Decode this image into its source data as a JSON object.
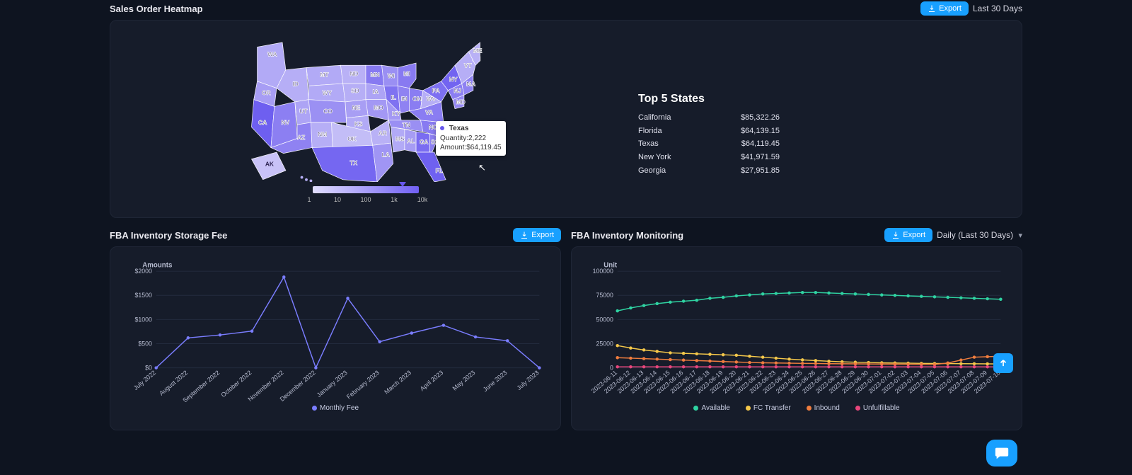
{
  "heatmap": {
    "title": "Sales Order Heatmap",
    "export": "Export",
    "range": "Last 30 Days",
    "tooltip": {
      "state": "Texas",
      "qty_label": "Quantity:",
      "qty": "2,222",
      "amt_label": "Amount:",
      "amt": "$64,119.45"
    },
    "legend_ticks": [
      "1",
      "10",
      "100",
      "1k",
      "10k"
    ],
    "top5_title": "Top 5 States",
    "top5": [
      {
        "state": "California",
        "amount": "$85,322.26"
      },
      {
        "state": "Florida",
        "amount": "$64,139.15"
      },
      {
        "state": "Texas",
        "amount": "$64,119.45"
      },
      {
        "state": "New York",
        "amount": "$41,971.59"
      },
      {
        "state": "Georgia",
        "amount": "$27,951.85"
      }
    ]
  },
  "storage": {
    "title": "FBA Inventory Storage Fee",
    "export": "Export",
    "y_title": "Amounts",
    "legend": "Monthly Fee",
    "y_ticks": [
      "$0",
      "$500",
      "$1000",
      "$1500",
      "$2000"
    ]
  },
  "monitor": {
    "title": "FBA Inventory Monitoring",
    "export": "Export",
    "range": "Daily (Last 30 Days)",
    "y_title": "Unit",
    "y_ticks": [
      "0",
      "25000",
      "50000",
      "75000",
      "100000"
    ],
    "legend": [
      {
        "label": "Available",
        "color": "#2fd3a2"
      },
      {
        "label": "FC Transfer",
        "color": "#f5c84a"
      },
      {
        "label": "Inbound",
        "color": "#f07d3e"
      },
      {
        "label": "Unfulfillable",
        "color": "#e8467c"
      }
    ]
  },
  "chart_data": [
    {
      "id": "storage_fee",
      "type": "line",
      "title": "FBA Inventory Storage Fee",
      "ylabel": "Amounts",
      "ylim": [
        0,
        2000
      ],
      "categories": [
        "July 2022",
        "August 2022",
        "September 2022",
        "October 2022",
        "November 2022",
        "December 2022",
        "January 2023",
        "February 2023",
        "March 2023",
        "April 2023",
        "May 2023",
        "June 2023",
        "July 2023"
      ],
      "series": [
        {
          "name": "Monthly Fee",
          "color": "#7a7dff",
          "values": [
            0,
            620,
            680,
            760,
            1880,
            0,
            1440,
            540,
            720,
            880,
            640,
            560,
            0
          ]
        }
      ]
    },
    {
      "id": "inventory_monitoring",
      "type": "line",
      "title": "FBA Inventory Monitoring",
      "ylabel": "Unit",
      "ylim": [
        0,
        100000
      ],
      "categories": [
        "2023-06-11",
        "2023-06-12",
        "2023-06-13",
        "2023-06-14",
        "2023-06-15",
        "2023-06-16",
        "2023-06-17",
        "2023-06-18",
        "2023-06-19",
        "2023-06-20",
        "2023-06-21",
        "2023-06-22",
        "2023-06-23",
        "2023-06-24",
        "2023-06-25",
        "2023-06-26",
        "2023-06-27",
        "2023-06-28",
        "2023-06-29",
        "2023-06-30",
        "2023-07-01",
        "2023-07-02",
        "2023-07-03",
        "2023-07-04",
        "2023-07-05",
        "2023-07-06",
        "2023-07-07",
        "2023-07-08",
        "2023-07-09",
        "2023-07-10"
      ],
      "series": [
        {
          "name": "Available",
          "color": "#2fd3a2",
          "values": [
            59000,
            62000,
            64500,
            66500,
            68000,
            69000,
            70000,
            72000,
            73000,
            74500,
            75500,
            76500,
            77000,
            77500,
            78000,
            78000,
            77500,
            77000,
            76500,
            76000,
            75500,
            75000,
            74500,
            74000,
            73500,
            73000,
            72500,
            72000,
            71500,
            71000
          ]
        },
        {
          "name": "FC Transfer",
          "color": "#f5c84a",
          "values": [
            23000,
            20500,
            18500,
            17000,
            15500,
            15000,
            14500,
            14000,
            13500,
            13000,
            12000,
            11000,
            10000,
            9000,
            8200,
            7500,
            6800,
            6200,
            5800,
            5500,
            5200,
            5000,
            4800,
            4600,
            4500,
            4400,
            4300,
            4200,
            4100,
            4000
          ]
        },
        {
          "name": "Inbound",
          "color": "#f07d3e",
          "values": [
            10500,
            10000,
            9500,
            9000,
            8500,
            8000,
            7500,
            7000,
            6500,
            6000,
            5500,
            5200,
            5000,
            4800,
            4600,
            4500,
            4300,
            4200,
            4100,
            4000,
            3900,
            3800,
            3700,
            3600,
            3500,
            5000,
            8000,
            11000,
            11500,
            12000
          ]
        },
        {
          "name": "Unfulfillable",
          "color": "#e8467c",
          "values": [
            1000,
            1000,
            1000,
            1000,
            1000,
            1000,
            1000,
            1000,
            1000,
            1000,
            1000,
            1000,
            1000,
            1000,
            1000,
            1000,
            1000,
            1000,
            1000,
            1000,
            1000,
            1000,
            1000,
            1000,
            1000,
            1000,
            1000,
            1000,
            1000,
            1000
          ]
        }
      ]
    }
  ]
}
